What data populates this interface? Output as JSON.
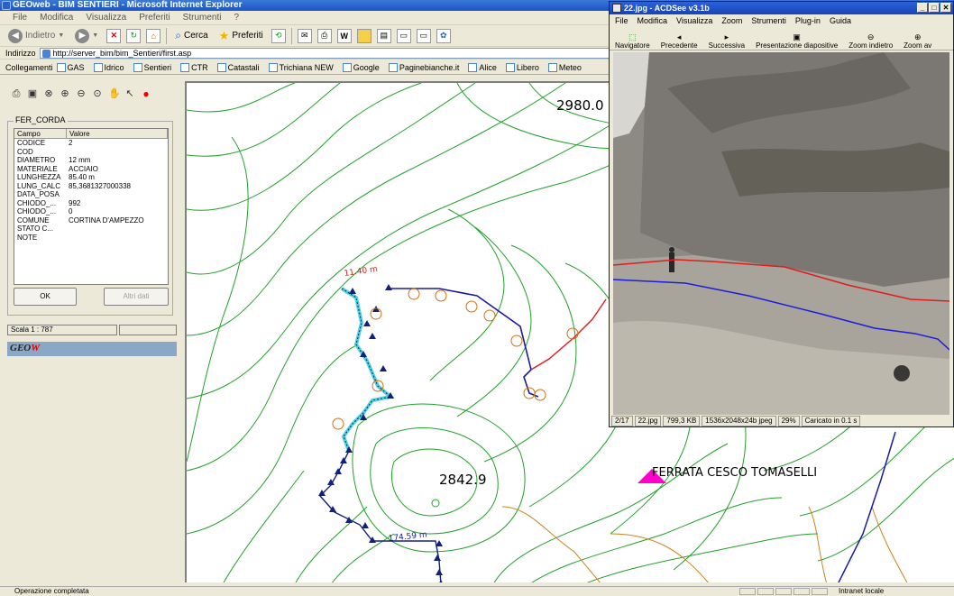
{
  "ie": {
    "title": "GEOweb - BIM SENTIERI - Microsoft Internet Explorer",
    "menu": [
      "File",
      "Modifica",
      "Visualizza",
      "Preferiti",
      "Strumenti",
      "?"
    ],
    "toolbar": {
      "back": "Indietro",
      "search": "Cerca",
      "favorites": "Preferiti"
    },
    "address_label": "Indirizzo",
    "address_url": "http://server_bim/bim_Sentieri/first.asp",
    "links_label": "Collegamenti",
    "links": [
      "GAS",
      "Idrico",
      "Sentieri",
      "CTR",
      "Catastali",
      "Trichiana NEW",
      "Google",
      "Paginebianche.it",
      "Alice",
      "Libero",
      "Meteo"
    ],
    "status_text": "Operazione completata",
    "zone_text": "Intranet locale"
  },
  "panel": {
    "legend": "FER_CORDA",
    "columns": [
      "Campo",
      "Valore"
    ],
    "rows": [
      {
        "field": "CODICE",
        "value": "2"
      },
      {
        "field": "COD",
        "value": ""
      },
      {
        "field": "DIAMETRO",
        "value": "12 mm"
      },
      {
        "field": "MATERIALE",
        "value": "ACCIAIO"
      },
      {
        "field": "LUNGHEZZA",
        "value": "85.40 m"
      },
      {
        "field": "LUNG_CALC",
        "value": "85,3681327000338"
      },
      {
        "field": "DATA_POSA",
        "value": ""
      },
      {
        "field": "CHIODO_...",
        "value": "992"
      },
      {
        "field": "CHIODO_...",
        "value": "0"
      },
      {
        "field": "COMUNE",
        "value": "CORTINA D'AMPEZZO"
      },
      {
        "field": "STATO C...",
        "value": ""
      },
      {
        "field": "NOTE",
        "value": ""
      }
    ],
    "ok_label": "OK",
    "other_label": "Altri dati",
    "scale_text": "Scala 1 : 787",
    "logo_text": "GEO",
    "logo_accent": "W"
  },
  "map": {
    "elevation_top": "2980.0",
    "elevation_mid": "2842.9",
    "label_ferrata": "FERRATA CESCO TOMASELLI",
    "label_cable_top": "11.40 m",
    "label_cable_bottom": "174.59 m",
    "colors": {
      "contour": "#22a02a",
      "contour_brown": "#c8841c",
      "path_blue": "#1a1aa8",
      "path_red": "#e01c1c",
      "cable_cyan": "#4fd2dc",
      "markers": "#102080",
      "poi": "#ff00cc"
    }
  },
  "acd": {
    "title": "22.jpg - ACDSee v3.1b",
    "menu": [
      "File",
      "Modifica",
      "Visualizza",
      "Zoom",
      "Strumenti",
      "Plug-in",
      "Guida"
    ],
    "tools": [
      "Navigatore",
      "Precedente",
      "Successiva",
      "Presentazione diapositive",
      "Zoom indietro",
      "Zoom av"
    ],
    "status": [
      "2/17",
      "22.jpg",
      "799,3 KB",
      "1536x2048x24b jpeg",
      "29%",
      "Caricato in 0.1 s"
    ]
  }
}
